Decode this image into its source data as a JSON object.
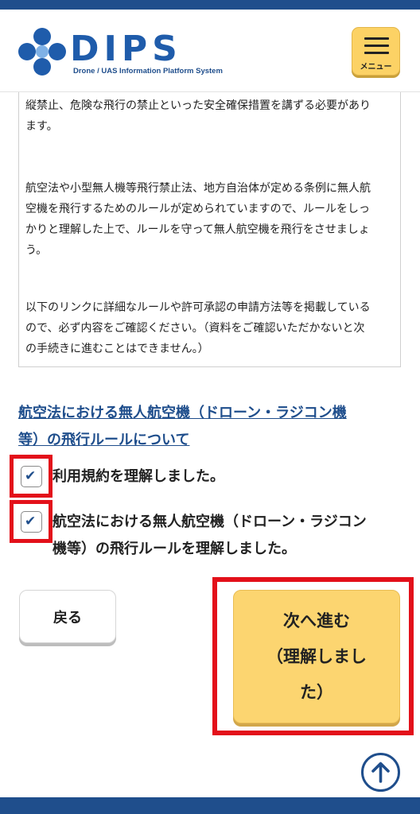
{
  "header": {
    "logo_title": "DIPS",
    "logo_subtitle": "Drone / UAS Information Platform System",
    "menu_label": "メニュー"
  },
  "notice": {
    "para1_line1": "縦禁止、危険な飛行の禁止といった安全確保措置を講ずる必要があり",
    "para1_line2": "ます。",
    "para2_line1": "航空法や小型無人機等飛行禁止法、地方自治体が定める条例に無人航",
    "para2_line2": "空機を飛行するためのルールが定められていますので、ルールをしっ",
    "para2_line3": "かりと理解した上で、ルールを守って無人航空機を飛行をさせましょ",
    "para2_line4": "う。",
    "para3_line1": "以下のリンクに詳細なルールや許可承認の申請方法等を掲載している",
    "para3_line2": "ので、必ず内容をご確認ください。（資料をご確認いただかないと次",
    "para3_line3": "の手続きに進むことはできません。）"
  },
  "rules_link": {
    "line1": "航空法における無人航空機（ドローン・ラジコン機",
    "line2": "等）の飛行ルールについて"
  },
  "checkboxes": {
    "terms_label": "利用規約を理解しました。",
    "terms_checked": true,
    "rules_label_line1": "航空法における無人航空機（ドローン・ラジコン",
    "rules_label_line2": "機等）の飛行ルールを理解しました。",
    "rules_checked": true,
    "check_glyph": "✔"
  },
  "buttons": {
    "back_label": "戻る",
    "next_line1": "次へ進む",
    "next_line2": "（理解しまし",
    "next_line3": "た）"
  },
  "icons": {
    "scroll_top": "arrow-up-circle-icon",
    "menu": "hamburger-icon",
    "logo": "dips-logo-icon"
  },
  "colors": {
    "brand_blue": "#1f4e8c",
    "accent_yellow": "#fcd570",
    "highlight_red": "#e3101a"
  }
}
